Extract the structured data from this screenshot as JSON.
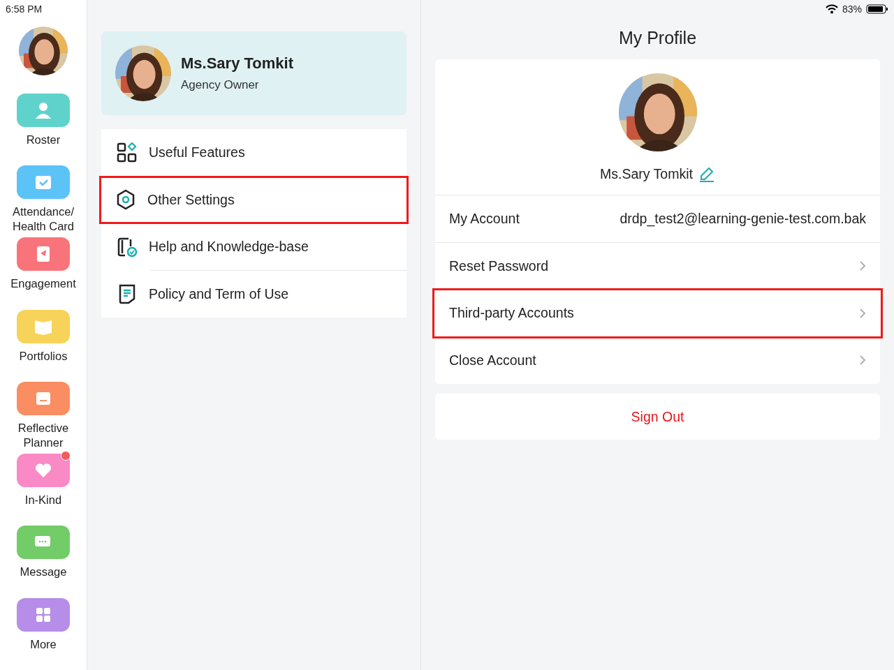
{
  "status_bar": {
    "time": "6:58 PM",
    "battery": "83%"
  },
  "sidebar": {
    "items": [
      {
        "label": "Roster",
        "kind": "roster",
        "color": "#5fd3cb",
        "badge": false
      },
      {
        "label": "Attendance/\nHealth Card",
        "kind": "attendance",
        "color": "#5cc3f7",
        "badge": false
      },
      {
        "label": "Engagement",
        "kind": "engagement",
        "color": "#f8747a",
        "badge": false
      },
      {
        "label": "Portfolios",
        "kind": "portfolios",
        "color": "#f8d35a",
        "badge": false
      },
      {
        "label": "Reflective\nPlanner",
        "kind": "planner",
        "color": "#fb8d62",
        "badge": false
      },
      {
        "label": "In-Kind",
        "kind": "inkind",
        "color": "#f98ac6",
        "badge": true
      },
      {
        "label": "Message",
        "kind": "message",
        "color": "#72cc68",
        "badge": false
      },
      {
        "label": "More",
        "kind": "more",
        "color": "#b68de9",
        "badge": false
      }
    ]
  },
  "profile_card": {
    "name": "Ms.Sary Tomkit",
    "role": "Agency Owner"
  },
  "menu": [
    {
      "label": "Useful Features",
      "kind": "features",
      "highlighted": false
    },
    {
      "label": "Other Settings",
      "kind": "settings",
      "highlighted": true
    },
    {
      "label": "Help and Knowledge-base",
      "kind": "help",
      "highlighted": false
    },
    {
      "label": "Policy and Term of Use",
      "kind": "policy",
      "highlighted": false
    }
  ],
  "profile": {
    "title": "My Profile",
    "name": "Ms.Sary Tomkit",
    "rows": [
      {
        "label": "My Account",
        "kind": "value",
        "value": "drdp_test2@learning-genie-test.com.bak",
        "highlighted": false
      },
      {
        "label": "Reset Password",
        "kind": "link",
        "highlighted": false
      },
      {
        "label": "Third-party Accounts",
        "kind": "link",
        "highlighted": true
      },
      {
        "label": "Close Account",
        "kind": "link",
        "highlighted": false
      }
    ],
    "sign_out": "Sign Out"
  }
}
